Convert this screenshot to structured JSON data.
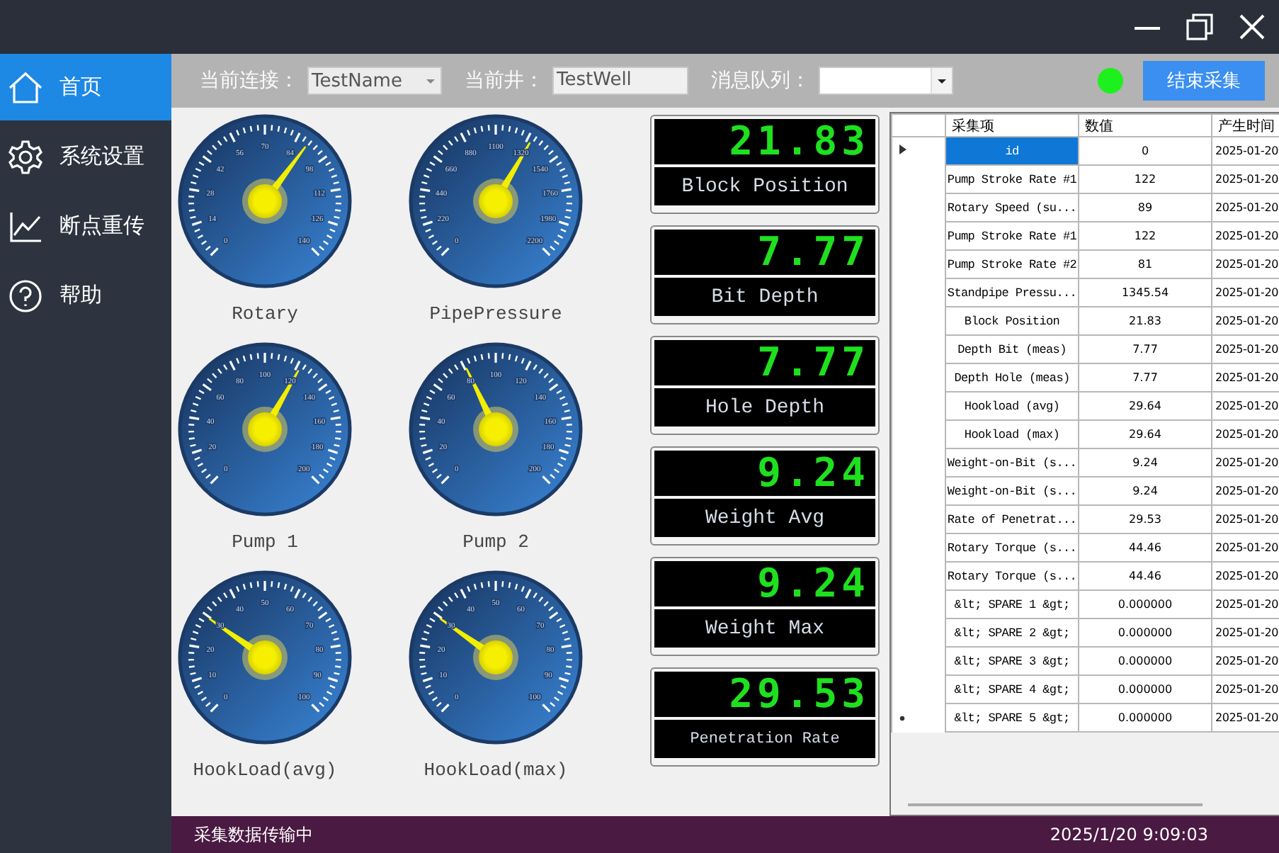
{
  "sidebar": {
    "items": [
      {
        "label": "首页",
        "selected": true
      },
      {
        "label": "系统设置",
        "selected": false
      },
      {
        "label": "断点重传",
        "selected": false
      },
      {
        "label": "帮助",
        "selected": false
      }
    ]
  },
  "toolbar": {
    "connection": {
      "label": "当前连接：",
      "value": "TestName"
    },
    "well": {
      "label": "当前井：",
      "value": "TestWell"
    },
    "queue": {
      "label": "消息队列："
    },
    "status_light": {
      "on": true
    },
    "stop_button": "结束采集"
  },
  "gauges": [
    {
      "label": "Rotary",
      "ticks": [
        "0",
        "14",
        "28",
        "42",
        "56",
        "70",
        "84",
        "98",
        "112",
        "126",
        "140"
      ],
      "level": 0.636
    },
    {
      "label": "PipePressure",
      "ticks": [
        "0",
        "220",
        "440",
        "660",
        "880",
        "1100",
        "1320",
        "1540",
        "1760",
        "1980",
        "2200"
      ],
      "level": 0.612
    },
    {
      "label": "Pump 1",
      "ticks": [
        "0",
        "20",
        "40",
        "60",
        "80",
        "100",
        "120",
        "140",
        "160",
        "180",
        "200"
      ],
      "level": 0.61
    },
    {
      "label": "Pump 2",
      "ticks": [
        "0",
        "20",
        "40",
        "60",
        "80",
        "100",
        "120",
        "140",
        "160",
        "180",
        "200"
      ],
      "level": 0.405
    },
    {
      "label": "HookLoad(avg)",
      "ticks": [
        "0",
        "10",
        "20",
        "30",
        "40",
        "50",
        "60",
        "70",
        "80",
        "90",
        "100"
      ],
      "level": 0.296
    },
    {
      "label": "HookLoad(max)",
      "ticks": [
        "0",
        "10",
        "20",
        "30",
        "40",
        "50",
        "60",
        "70",
        "80",
        "90",
        "100"
      ],
      "level": 0.296
    }
  ],
  "displays": [
    {
      "value": "21.83",
      "label": "Block Position"
    },
    {
      "value": "7.77",
      "label": "Bit Depth"
    },
    {
      "value": "7.77",
      "label": "Hole Depth"
    },
    {
      "value": "9.24",
      "label": "Weight Avg"
    },
    {
      "value": "9.24",
      "label": "Weight Max"
    },
    {
      "value": "29.53",
      "label": "Penetration Rate"
    }
  ],
  "table": {
    "columns": [
      "采集项",
      "数值",
      "产生时间"
    ],
    "rows": [
      {
        "kind": "current",
        "selected": true,
        "cells": [
          "id",
          "0",
          "2025-01-20"
        ]
      },
      {
        "selected": false,
        "cells": [
          "Pump Stroke Rate #1",
          "122",
          "2025-01-20"
        ]
      },
      {
        "selected": false,
        "cells": [
          "Rotary Speed (su...",
          "89",
          "2025-01-20"
        ]
      },
      {
        "selected": false,
        "cells": [
          "Pump Stroke Rate #1",
          "122",
          "2025-01-20"
        ]
      },
      {
        "selected": false,
        "cells": [
          "Pump Stroke Rate #2",
          "81",
          "2025-01-20"
        ]
      },
      {
        "selected": false,
        "cells": [
          "Standpipe Pressu...",
          "1345.54",
          "2025-01-20"
        ]
      },
      {
        "selected": false,
        "cells": [
          "Block Position",
          "21.83",
          "2025-01-20"
        ]
      },
      {
        "selected": false,
        "cells": [
          "Depth Bit (meas)",
          "7.77",
          "2025-01-20"
        ]
      },
      {
        "selected": false,
        "cells": [
          "Depth Hole (meas)",
          "7.77",
          "2025-01-20"
        ]
      },
      {
        "selected": false,
        "cells": [
          "Hookload (avg)",
          "29.64",
          "2025-01-20"
        ]
      },
      {
        "selected": false,
        "cells": [
          "Hookload (max)",
          "29.64",
          "2025-01-20"
        ]
      },
      {
        "selected": false,
        "cells": [
          "Weight-on-Bit (s...",
          "9.24",
          "2025-01-20"
        ]
      },
      {
        "selected": false,
        "cells": [
          "Weight-on-Bit (s...",
          "9.24",
          "2025-01-20"
        ]
      },
      {
        "selected": false,
        "cells": [
          "Rate of Penetrat...",
          "29.53",
          "2025-01-20"
        ]
      },
      {
        "selected": false,
        "cells": [
          "Rotary Torque (s...",
          "44.46",
          "2025-01-20"
        ]
      },
      {
        "selected": false,
        "cells": [
          "Rotary Torque (s...",
          "44.46",
          "2025-01-20"
        ]
      },
      {
        "selected": false,
        "cells": [
          "&lt; SPARE 1 &gt;",
          "0.000000",
          "2025-01-20"
        ]
      },
      {
        "selected": false,
        "cells": [
          "&lt; SPARE 2 &gt;",
          "0.000000",
          "2025-01-20"
        ]
      },
      {
        "selected": false,
        "cells": [
          "&lt; SPARE 3 &gt;",
          "0.000000",
          "2025-01-20"
        ]
      },
      {
        "selected": false,
        "cells": [
          "&lt; SPARE 4 &gt;",
          "0.000000",
          "2025-01-20"
        ]
      },
      {
        "kind": "new",
        "selected": false,
        "cells": [
          "&lt; SPARE 5 &gt;",
          "0.000000",
          "2025-01-20"
        ]
      }
    ]
  },
  "status_bar": {
    "message": "采集数据传输中",
    "time": "2025/1/20 9:09:03"
  }
}
